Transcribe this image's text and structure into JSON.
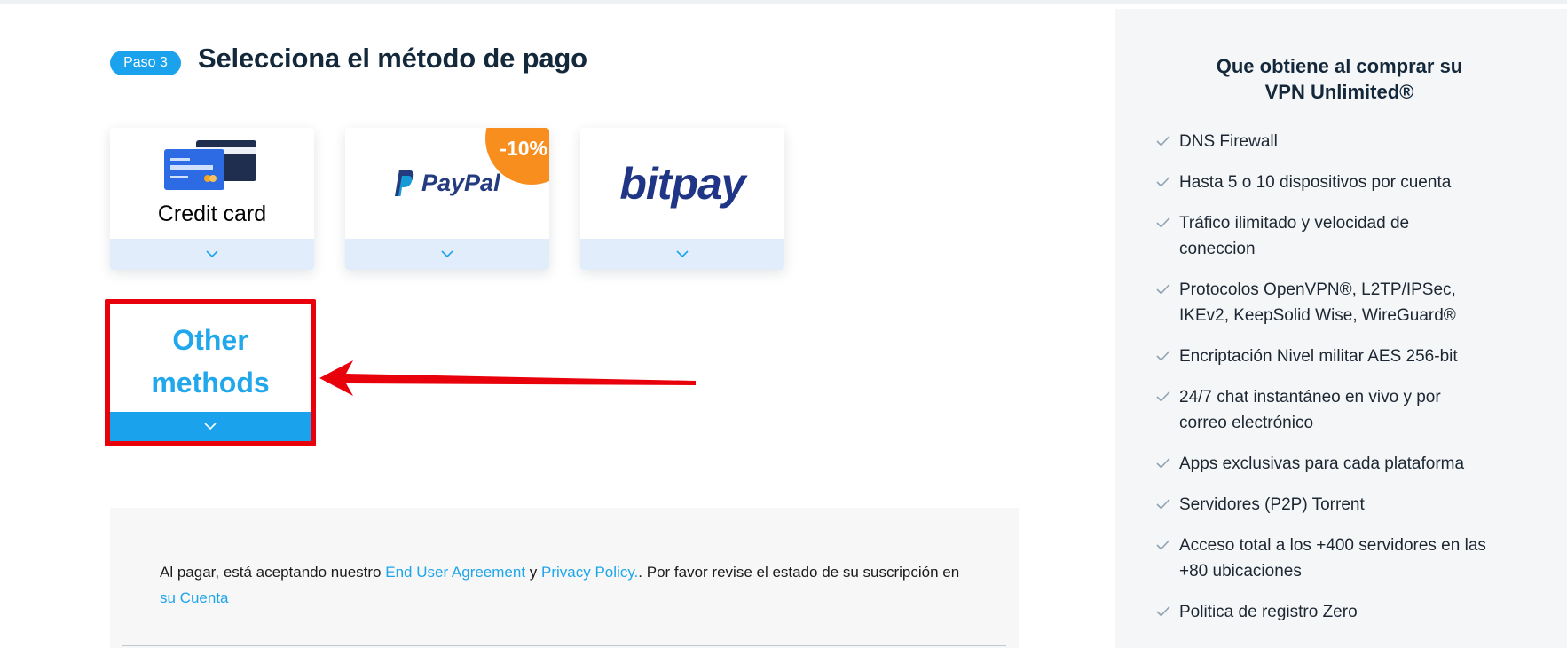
{
  "step": {
    "badge": "Paso 3",
    "title": "Selecciona el método de pago"
  },
  "payment_methods": {
    "credit_card": {
      "label": "Credit card",
      "icon": "credit-card-icon"
    },
    "paypal": {
      "label": "PayPal",
      "discount": "-10%",
      "icon": "paypal-logo"
    },
    "bitpay": {
      "label": "bitpay",
      "icon": "bitpay-logo"
    },
    "other": {
      "line1": "Other",
      "line2": "methods"
    },
    "expand_icon": "chevron-down-icon"
  },
  "agreement": {
    "text_before": "Al pagar, está aceptando nuestro ",
    "eula_link": "End User Agreement",
    "text_and": " y ",
    "privacy_link": "Privacy Policy.",
    "text_after": ". Por favor revise el estado de su suscripción en ",
    "account_link": "su Cuenta"
  },
  "sidebar": {
    "title_line1": "Que obtiene al comprar su",
    "title_line2": "VPN Unlimited®",
    "features": [
      {
        "line1": "DNS Firewall",
        "line2": ""
      },
      {
        "line1": "Hasta 5 o 10 dispositivos por cuenta",
        "line2": ""
      },
      {
        "line1": "Tráfico ilimitado y velocidad de",
        "line2": "coneccion"
      },
      {
        "line1": "Protocolos OpenVPN®, L2TP/IPSec,",
        "line2": "IKEv2, KeepSolid Wise, WireGuard®"
      },
      {
        "line1": "Encriptación Nivel militar AES 256-bit",
        "line2": ""
      },
      {
        "line1": "24/7 chat instantáneo en vivo y por",
        "line2": "correo electrónico"
      },
      {
        "line1": "Apps exclusivas para cada plataforma",
        "line2": ""
      },
      {
        "line1": "Servidores (P2P) Torrent",
        "line2": ""
      },
      {
        "line1": "Acceso total a los +400 servidores en las",
        "line2": "+80 ubicaciones"
      },
      {
        "line1": "Politica de registro Zero",
        "line2": ""
      }
    ]
  },
  "colors": {
    "accent": "#1aa3ec",
    "highlight": "#e8000b",
    "paypal_blue": "#253b80",
    "discount_orange": "#f78e1e"
  }
}
